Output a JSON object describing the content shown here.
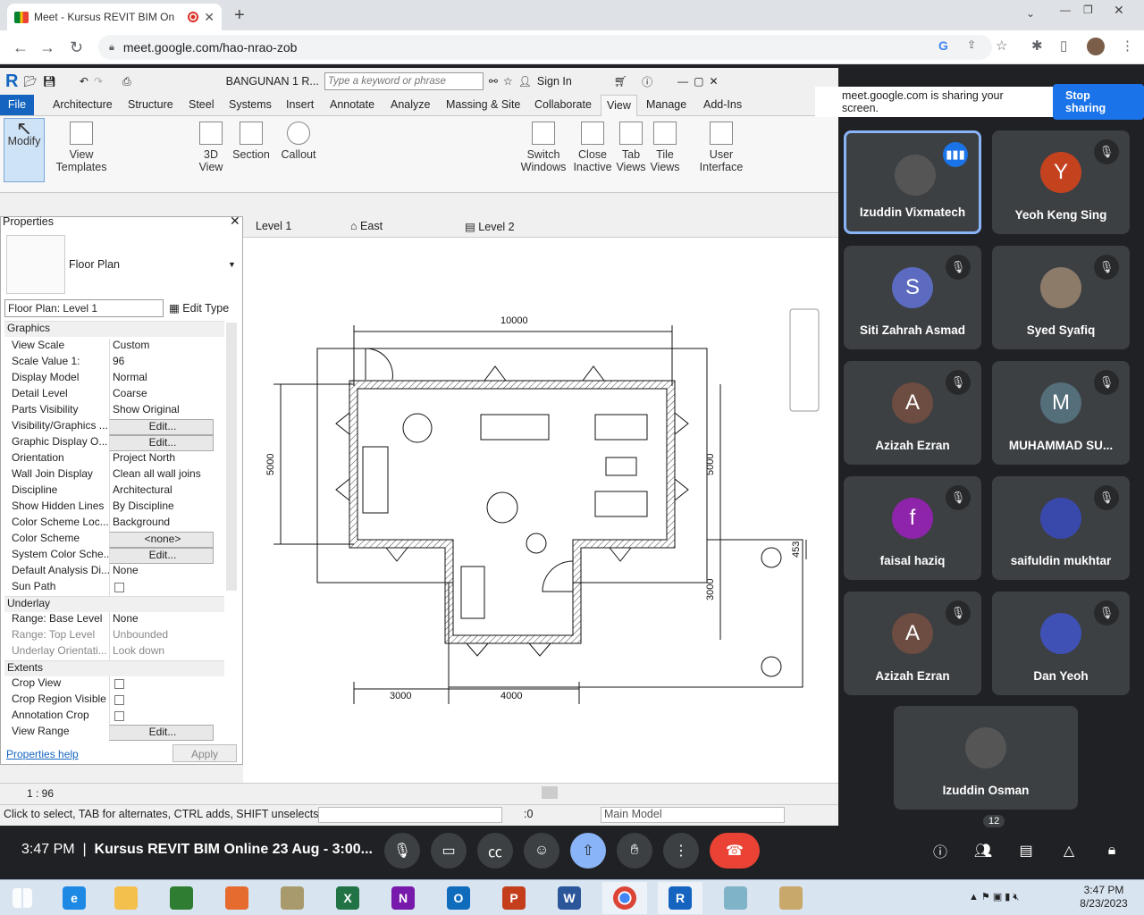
{
  "browser": {
    "tab_title": "Meet - Kursus REVIT BIM On",
    "url": "meet.google.com/hao-nrao-zob"
  },
  "revit": {
    "doc_title": "BANGUNAN 1 R...",
    "search_placeholder": "Type a keyword or phrase",
    "sign_in": "Sign In",
    "tabs": [
      "File",
      "Architecture",
      "Structure",
      "Steel",
      "Systems",
      "Insert",
      "Annotate",
      "Analyze",
      "Massing & Site",
      "Collaborate",
      "View",
      "Manage",
      "Add-Ins"
    ],
    "active_tab": "View",
    "ribbon": {
      "modify": "Modify",
      "view_templates": "View Templates",
      "view3d": "3D View",
      "section": "Section",
      "callout": "Callout",
      "switch_windows": "Switch Windows",
      "close_inactive": "Close Inactive",
      "tab_views": "Tab Views",
      "tile_views": "Tile Views",
      "user_interface": "User Interface"
    },
    "properties": {
      "title": "Properties",
      "type": "Floor Plan",
      "selector": "Floor Plan: Level 1",
      "edit_type": "Edit Type",
      "graphics": "Graphics",
      "underlay": "Underlay",
      "extents": "Extents",
      "rows": [
        {
          "k": "View Scale",
          "v": "Custom"
        },
        {
          "k": "Scale Value    1:",
          "v": "96"
        },
        {
          "k": "Display Model",
          "v": "Normal"
        },
        {
          "k": "Detail Level",
          "v": "Coarse"
        },
        {
          "k": "Parts Visibility",
          "v": "Show Original"
        },
        {
          "k": "Visibility/Graphics ...",
          "v": "Edit..."
        },
        {
          "k": "Graphic Display O...",
          "v": "Edit..."
        },
        {
          "k": "Orientation",
          "v": "Project North"
        },
        {
          "k": "Wall Join Display",
          "v": "Clean all wall joins"
        },
        {
          "k": "Discipline",
          "v": "Architectural"
        },
        {
          "k": "Show Hidden Lines",
          "v": "By Discipline"
        },
        {
          "k": "Color Scheme Loc...",
          "v": "Background"
        },
        {
          "k": "Color Scheme",
          "v": "<none>"
        },
        {
          "k": "System Color Sche...",
          "v": "Edit..."
        },
        {
          "k": "Default Analysis Di...",
          "v": "None"
        },
        {
          "k": "Sun Path",
          "v": ""
        }
      ],
      "underlay_rows": [
        {
          "k": "Range: Base Level",
          "v": "None"
        },
        {
          "k": "Range: Top Level",
          "v": "Unbounded"
        },
        {
          "k": "Underlay Orientati...",
          "v": "Look down"
        }
      ],
      "extent_rows": [
        {
          "k": "Crop View",
          "v": ""
        },
        {
          "k": "Crop Region Visible",
          "v": ""
        },
        {
          "k": "Annotation Crop",
          "v": ""
        },
        {
          "k": "View Range",
          "v": "Edit..."
        }
      ],
      "help": "Properties help",
      "apply": "Apply"
    },
    "view_tabs": [
      "Level 1",
      "East",
      "Level 2"
    ],
    "dims": {
      "top": "10000",
      "left": "5000",
      "right": "5000",
      "r_small": "453",
      "r_low": "3000",
      "b_left": "3000",
      "b_mid": "4000"
    },
    "scale": "1 : 96",
    "status": "Click to select, TAB for alternates, CTRL adds, SHIFT unselects",
    "status_count": ":0",
    "model": "Main Model"
  },
  "meet": {
    "share_msg": "meet.google.com is sharing your screen.",
    "stop": "Stop sharing",
    "participants": [
      {
        "name": "Izuddin Vixmatech",
        "letter": "",
        "color": "#555"
      },
      {
        "name": "Yeoh Keng Sing",
        "letter": "Y",
        "color": "#c5421f"
      },
      {
        "name": "Siti Zahrah Asmad",
        "letter": "S",
        "color": "#5c6bc0"
      },
      {
        "name": "Syed Syafiq",
        "letter": "",
        "color": "#8d7b6a"
      },
      {
        "name": "Azizah Ezran",
        "letter": "A",
        "color": "#6d4c41"
      },
      {
        "name": "MUHAMMAD SU...",
        "letter": "M",
        "color": "#546e7a"
      },
      {
        "name": "faisal haziq",
        "letter": "f",
        "color": "#8e24aa"
      },
      {
        "name": "saifuldin mukhtar",
        "letter": "",
        "color": "#3949ab"
      },
      {
        "name": "Azizah Ezran",
        "letter": "A",
        "color": "#6d4c41"
      },
      {
        "name": "Dan Yeoh",
        "letter": "",
        "color": "#3f51b5"
      },
      {
        "name": "Izuddin Osman",
        "letter": "",
        "color": "#555"
      }
    ],
    "time": "3:47 PM",
    "meeting": "Kursus REVIT BIM Online 23 Aug - 3:00...",
    "people_count": "12"
  },
  "taskbar": {
    "time": "3:47 PM",
    "date": "8/23/2023"
  }
}
